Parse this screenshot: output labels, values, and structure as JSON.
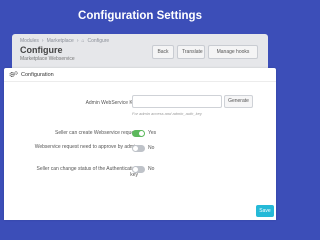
{
  "heading": "Configuration Settings",
  "breadcrumb": {
    "part1": "Modules",
    "part2": "Marketplace",
    "part3": "Configure"
  },
  "header": {
    "title": "Configure",
    "subtitle": "Marketplace Webservice",
    "buttons": {
      "back": "Back",
      "translate": "Translate",
      "hooks": "Manage hooks"
    }
  },
  "card": {
    "title": "Configuration",
    "key_label": "Admin WebService Key",
    "key_value": "",
    "generate_label": "Generate",
    "key_help": "For admin access and admin_auth_key",
    "rows": [
      {
        "label": "Seller can create Webservice request",
        "state": "Yes",
        "on": true
      },
      {
        "label": "Webservice request need to approve by admin",
        "state": "No",
        "on": false
      },
      {
        "label": "Seller can change status of the Authentication key",
        "state": "No",
        "on": false
      }
    ],
    "save_label": "Save"
  },
  "colors": {
    "background": "#3c4eb8",
    "toggle_on": "#5cb85c",
    "save_button": "#25b9d7"
  },
  "icons": {
    "card_header": "cogs-icon",
    "breadcrumb": "home-icon"
  }
}
